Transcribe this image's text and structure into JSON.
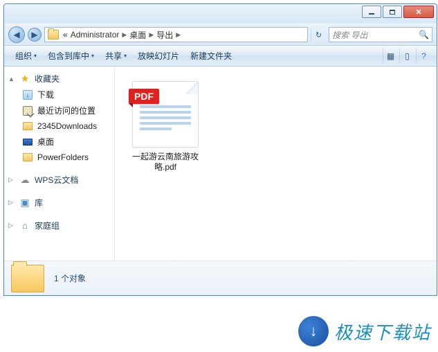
{
  "titlebar": {
    "min": "—",
    "max": "▢",
    "close": "✕"
  },
  "address": {
    "prefix": "«",
    "segs": [
      "Administrator",
      "桌面",
      "导出"
    ],
    "refresh": "↻"
  },
  "search": {
    "placeholder": "搜索 导出",
    "icon": "🔍"
  },
  "toolbar": {
    "organize": "组织",
    "include": "包含到库中",
    "share": "共享",
    "slideshow": "放映幻灯片",
    "newfolder": "新建文件夹",
    "dd": "▾"
  },
  "nav": {
    "favorites": {
      "label": "收藏夹",
      "items": [
        {
          "key": "downloads",
          "label": "下载"
        },
        {
          "key": "recent",
          "label": "最近访问的位置"
        },
        {
          "key": "2345",
          "label": "2345Downloads"
        },
        {
          "key": "desktop",
          "label": "桌面"
        },
        {
          "key": "powerfolders",
          "label": "PowerFolders"
        }
      ]
    },
    "wps": {
      "label": "WPS云文档"
    },
    "libraries": {
      "label": "库"
    },
    "homegroup": {
      "label": "家庭组"
    }
  },
  "files": [
    {
      "badge": "PDF",
      "name": "一起游云南旅游攻略.pdf"
    }
  ],
  "status": {
    "count": "1 个对象"
  },
  "watermark": {
    "text": "极速下载站"
  }
}
